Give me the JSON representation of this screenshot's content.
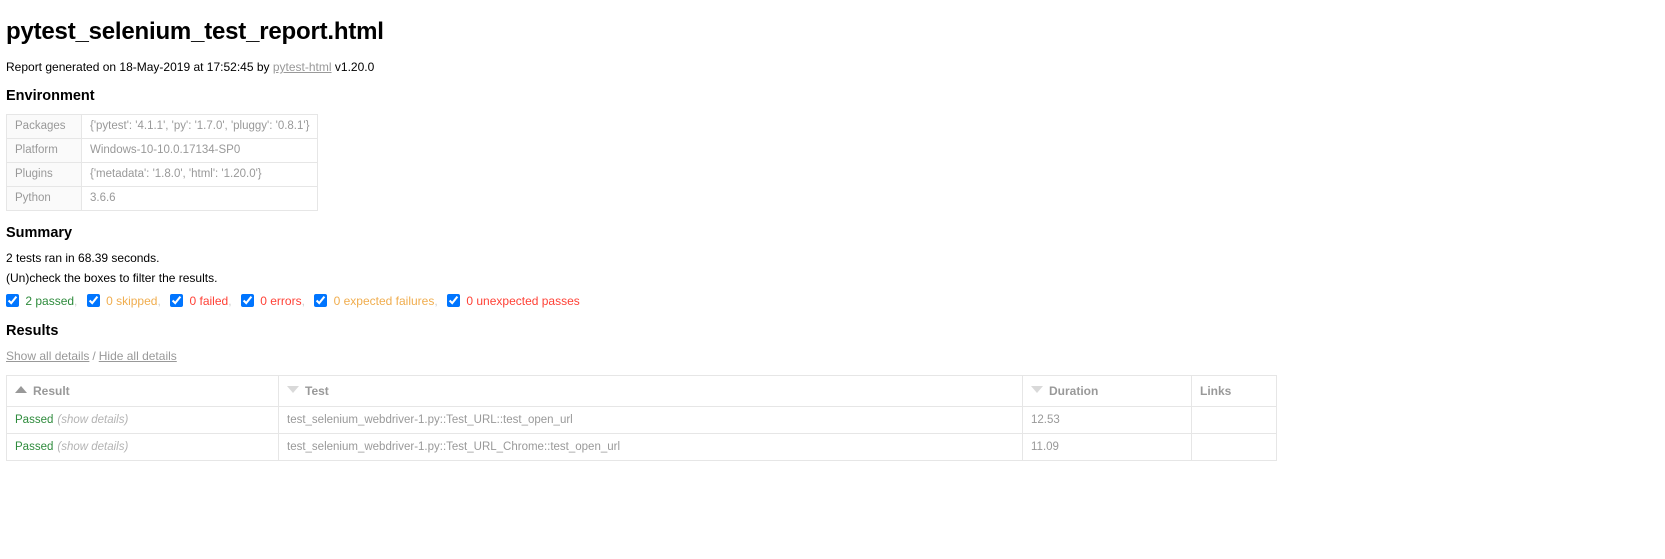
{
  "report": {
    "title": "pytest_selenium_test_report.html",
    "generated_prefix": "Report generated on 18-May-2019 at 17:52:45 by",
    "generator_link": "pytest-html",
    "generator_version": "v1.20.0"
  },
  "environment": {
    "heading": "Environment",
    "rows": [
      {
        "key": "Packages",
        "value": "{'pytest': '4.1.1', 'py': '1.7.0', 'pluggy': '0.8.1'}"
      },
      {
        "key": "Platform",
        "value": "Windows-10-10.0.17134-SP0"
      },
      {
        "key": "Plugins",
        "value": "{'metadata': '1.8.0', 'html': '1.20.0'}"
      },
      {
        "key": "Python",
        "value": "3.6.6"
      }
    ]
  },
  "summary": {
    "heading": "Summary",
    "run_line": "2 tests ran in 68.39 seconds.",
    "filter_hint": "(Un)check the boxes to filter the results.",
    "filters": [
      {
        "label": "2 passed",
        "color": "#2e8b3c",
        "checked": true,
        "trailing": ","
      },
      {
        "label": "0 skipped",
        "color": "#f0ad4e",
        "checked": true,
        "trailing": ","
      },
      {
        "label": "0 failed",
        "color": "#ff4136",
        "checked": true,
        "trailing": ","
      },
      {
        "label": "0 errors",
        "color": "#ff4136",
        "checked": true,
        "trailing": ","
      },
      {
        "label": "0 expected failures",
        "color": "#f0ad4e",
        "checked": true,
        "trailing": ","
      },
      {
        "label": "0 unexpected passes",
        "color": "#ff4136",
        "checked": true,
        "trailing": ""
      }
    ]
  },
  "results": {
    "heading": "Results",
    "show_all_label": "Show all details",
    "separator": "/",
    "hide_all_label": "Hide all details",
    "columns": [
      {
        "label": "Result",
        "sort": "asc"
      },
      {
        "label": "Test",
        "sort": "desc"
      },
      {
        "label": "Duration",
        "sort": "desc"
      },
      {
        "label": "Links",
        "sort": "none"
      }
    ],
    "rows": [
      {
        "result": "Passed",
        "details_label": "(show details)",
        "test": "test_selenium_webdriver-1.py::Test_URL::test_open_url",
        "duration": "12.53",
        "links": ""
      },
      {
        "result": "Passed",
        "details_label": "(show details)",
        "test": "test_selenium_webdriver-1.py::Test_URL_Chrome::test_open_url",
        "duration": "11.09",
        "links": ""
      }
    ]
  }
}
